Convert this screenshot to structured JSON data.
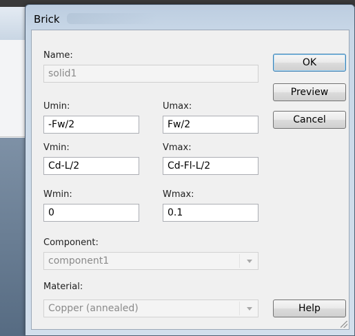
{
  "dialog": {
    "title": "Brick"
  },
  "name": {
    "label": "Name:",
    "value": "solid1"
  },
  "umin": {
    "label": "Umin:",
    "value": "-Fw/2"
  },
  "umax": {
    "label": "Umax:",
    "value": "Fw/2"
  },
  "vmin": {
    "label": "Vmin:",
    "value": "Cd-L/2"
  },
  "vmax": {
    "label": "Vmax:",
    "value": "Cd-Fl-L/2"
  },
  "wmin": {
    "label": "Wmin:",
    "value": "0"
  },
  "wmax": {
    "label": "Wmax:",
    "value": "0.1"
  },
  "component": {
    "label": "Component:",
    "value": "component1"
  },
  "material": {
    "label": "Material:",
    "value": "Copper (annealed)"
  },
  "buttons": {
    "ok": "OK",
    "preview": "Preview",
    "cancel": "Cancel",
    "help": "Help"
  }
}
